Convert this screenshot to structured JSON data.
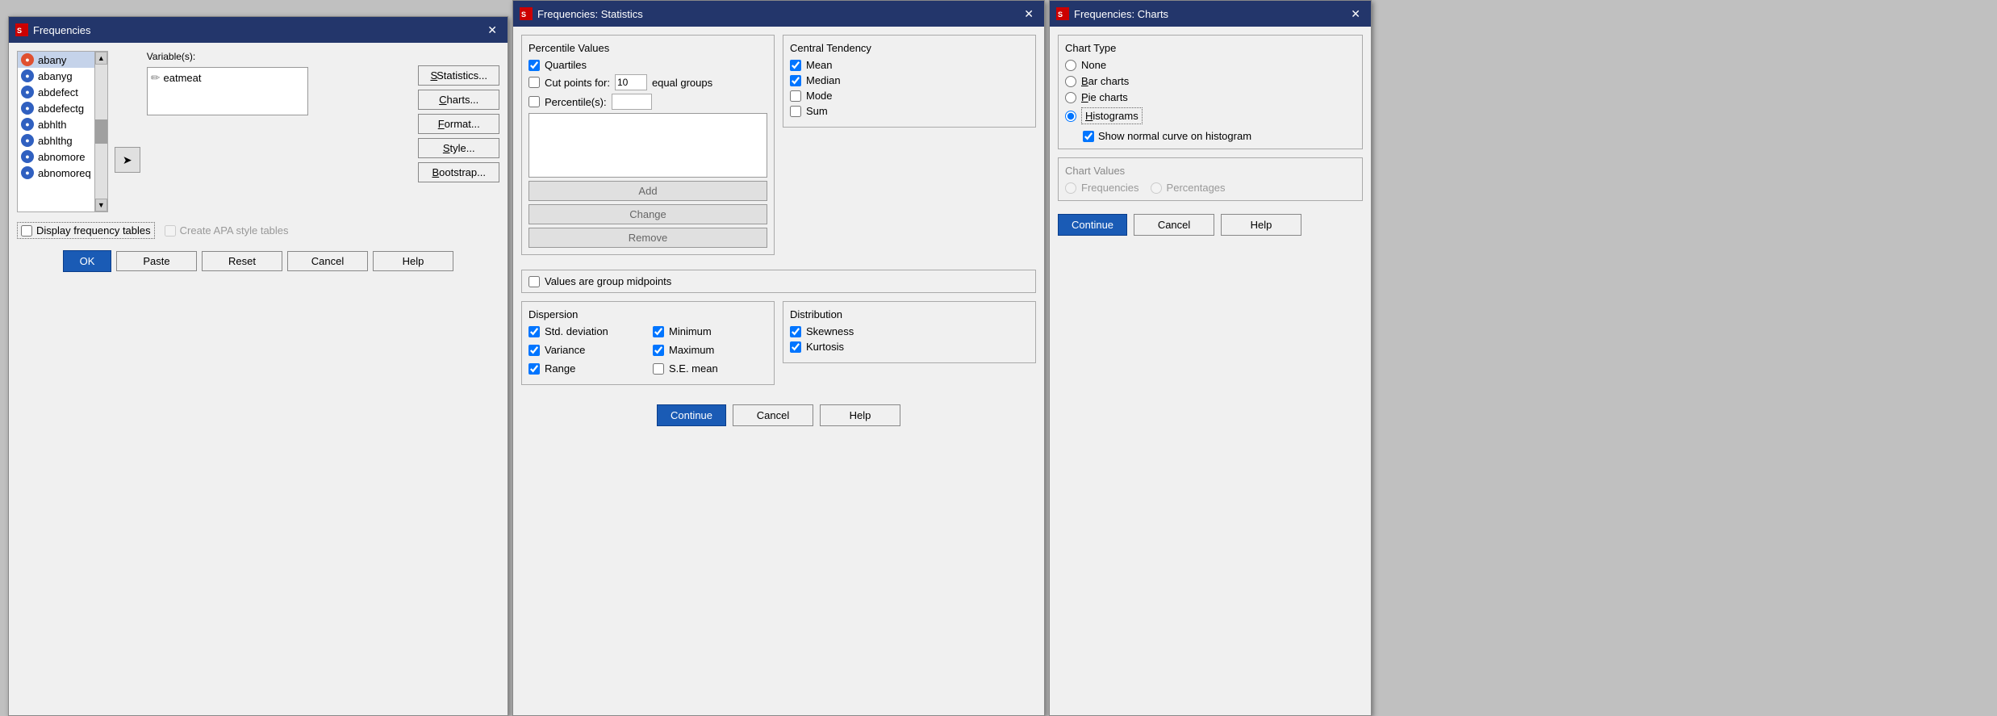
{
  "frequencies_window": {
    "title": "Frequencies",
    "variables_label": "Variable(s):",
    "var_list": [
      {
        "name": "abany",
        "color": "#e05030",
        "selected": true
      },
      {
        "name": "abanyg",
        "color": "#3060c0"
      },
      {
        "name": "abdefect",
        "color": "#3060c0"
      },
      {
        "name": "abdefectg",
        "color": "#3060c0"
      },
      {
        "name": "abhlth",
        "color": "#3060c0"
      },
      {
        "name": "abhlthg",
        "color": "#3060c0"
      },
      {
        "name": "abnomore",
        "color": "#3060c0"
      },
      {
        "name": "abnomoreq",
        "color": "#3060c0"
      }
    ],
    "selected_vars": [
      "eatmeat"
    ],
    "display_freq_tables": false,
    "display_freq_tables_label": "Display frequency tables",
    "create_apa_label": "Create APA style tables",
    "buttons": {
      "statistics": "Statistics...",
      "charts": "Charts...",
      "format": "Format...",
      "style": "Style...",
      "bootstrap": "Bootstrap..."
    },
    "ok_label": "OK",
    "paste_label": "Paste",
    "reset_label": "Reset",
    "cancel_label": "Cancel",
    "help_label": "Help"
  },
  "statistics_window": {
    "title": "Frequencies: Statistics",
    "percentile_values": {
      "title": "Percentile Values",
      "quartiles_checked": true,
      "quartiles_label": "Quartiles",
      "cut_points_checked": false,
      "cut_points_label": "Cut points for:",
      "cut_points_value": "10",
      "cut_points_suffix": "equal groups",
      "percentiles_checked": false,
      "percentiles_label": "Percentile(s):",
      "add_label": "Add",
      "change_label": "Change",
      "remove_label": "Remove"
    },
    "central_tendency": {
      "title": "Central Tendency",
      "mean_checked": true,
      "mean_label": "Mean",
      "median_checked": true,
      "median_label": "Median",
      "mode_checked": false,
      "mode_label": "Mode",
      "sum_checked": false,
      "sum_label": "Sum"
    },
    "values_group_midpoints": {
      "checked": false,
      "label": "Values are group midpoints"
    },
    "dispersion": {
      "title": "Dispersion",
      "std_dev_checked": true,
      "std_dev_label": "Std. deviation",
      "variance_checked": true,
      "variance_label": "Variance",
      "range_checked": true,
      "range_label": "Range",
      "minimum_checked": true,
      "minimum_label": "Minimum",
      "maximum_checked": true,
      "maximum_label": "Maximum",
      "se_mean_checked": false,
      "se_mean_label": "S.E. mean"
    },
    "distribution": {
      "title": "Distribution",
      "skewness_checked": true,
      "skewness_label": "Skewness",
      "kurtosis_checked": true,
      "kurtosis_label": "Kurtosis"
    },
    "buttons": {
      "continue": "Continue",
      "cancel": "Cancel",
      "help": "Help"
    }
  },
  "charts_window": {
    "title": "Frequencies: Charts",
    "chart_type_title": "Chart Type",
    "none_label": "None",
    "bar_charts_label": "Bar charts",
    "pie_charts_label": "Pie charts",
    "histograms_label": "Histograms",
    "histograms_selected": true,
    "show_normal_curve_label": "Show normal curve on histogram",
    "show_normal_curve_checked": true,
    "chart_values_title": "Chart Values",
    "frequencies_label": "Frequencies",
    "percentages_label": "Percentages",
    "buttons": {
      "continue": "Continue",
      "cancel": "Cancel",
      "help": "Help"
    }
  }
}
